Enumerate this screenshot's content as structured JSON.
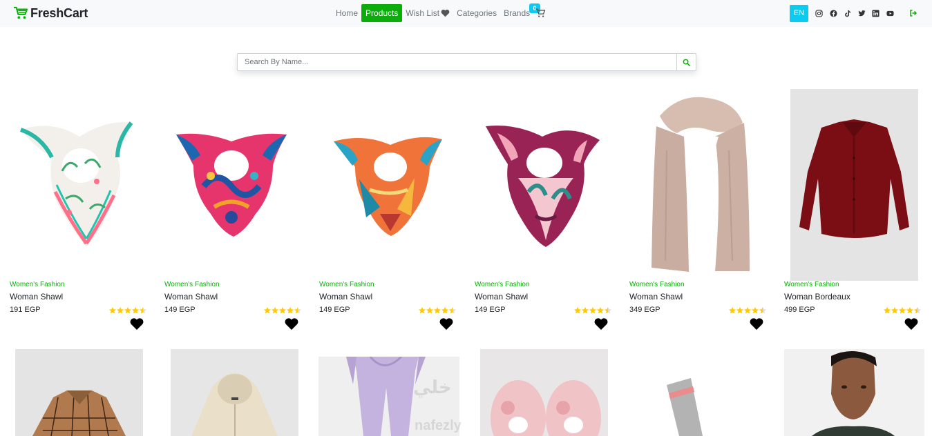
{
  "brand": {
    "name": "FreshCart",
    "accent": "#0aad0a"
  },
  "nav": {
    "links": [
      {
        "label": "Home",
        "active": false
      },
      {
        "label": "Products",
        "active": true
      },
      {
        "label": "Wish List",
        "active": false
      },
      {
        "label": "Categories",
        "active": false
      },
      {
        "label": "Brands",
        "active": false
      }
    ],
    "cart_count": "0",
    "language": "EN",
    "socials": [
      "instagram-icon",
      "facebook-icon",
      "tiktok-icon",
      "twitter-icon",
      "linkedin-icon",
      "youtube-icon"
    ]
  },
  "search": {
    "placeholder": "Search By Name...",
    "value": ""
  },
  "products": [
    {
      "category": "Women's Fashion",
      "title": "Woman Shawl",
      "price": "191 EGP",
      "rating_stars": 4.5,
      "image": "scarf-floral-white"
    },
    {
      "category": "Women's Fashion",
      "title": "Woman Shawl",
      "price": "149 EGP",
      "rating_stars": 4.5,
      "image": "scarf-pink-blue"
    },
    {
      "category": "Women's Fashion",
      "title": "Woman Shawl",
      "price": "149 EGP",
      "rating_stars": 4.5,
      "image": "scarf-orange-teal"
    },
    {
      "category": "Women's Fashion",
      "title": "Woman Shawl",
      "price": "149 EGP",
      "rating_stars": 4.5,
      "image": "scarf-purple-pink"
    },
    {
      "category": "Women's Fashion",
      "title": "Woman Shawl",
      "price": "349 EGP",
      "rating_stars": 4.5,
      "image": "scarf-beige-long"
    },
    {
      "category": "Women's Fashion",
      "title": "Woman Bordeaux",
      "price": "499 EGP",
      "rating_stars": 4.5,
      "image": "blouse-bordeaux"
    }
  ],
  "products_row2": [
    {
      "image": "shirt-brown-plaid"
    },
    {
      "image": "hoodie-cream"
    },
    {
      "image": "joggers-lilac"
    },
    {
      "image": "slippers-pink"
    },
    {
      "image": "socks-grey"
    },
    {
      "image": "man-portrait"
    }
  ],
  "colors": {
    "star": "#ffc908",
    "category": "#0aad0a",
    "lang": "#0dcaf0",
    "logout": "#0aad0a"
  }
}
